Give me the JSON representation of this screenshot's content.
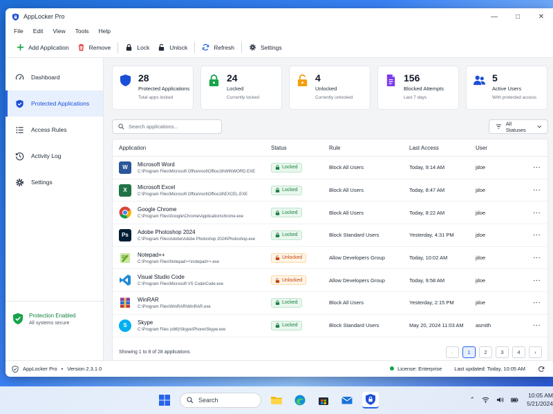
{
  "window": {
    "title": "AppLocker Pro"
  },
  "menu": [
    "File",
    "Edit",
    "View",
    "Tools",
    "Help"
  ],
  "toolbar": {
    "add": "Add Application",
    "remove": "Remove",
    "lock": "Lock",
    "unlock": "Unlock",
    "refresh": "Refresh",
    "settings": "Settings"
  },
  "sidebar": {
    "items": [
      {
        "label": "Dashboard",
        "icon": "gauge-icon"
      },
      {
        "label": "Protected Applications",
        "icon": "shield-check-icon"
      },
      {
        "label": "Access Rules",
        "icon": "list-icon"
      },
      {
        "label": "Activity Log",
        "icon": "history-icon"
      },
      {
        "label": "Settings",
        "icon": "gear-icon"
      }
    ],
    "active_index": 1,
    "protection": {
      "title": "Protection Enabled",
      "subtitle": "All systems secure"
    }
  },
  "stats": [
    {
      "value": "28",
      "label": "Protected Applications",
      "sub": "Total apps locked",
      "icon": "shield-icon",
      "color": "#1d4ed8"
    },
    {
      "value": "24",
      "label": "Locked",
      "sub": "Currently locked",
      "icon": "lock-icon",
      "color": "#16a34a"
    },
    {
      "value": "4",
      "label": "Unlocked",
      "sub": "Currently unlocked",
      "icon": "unlock-icon",
      "color": "#f59e0b"
    },
    {
      "value": "156",
      "label": "Blocked Attempts",
      "sub": "Last 7 days",
      "icon": "file-blocked-icon",
      "color": "#7c3aed"
    },
    {
      "value": "5",
      "label": "Active Users",
      "sub": "With protected access",
      "icon": "users-icon",
      "color": "#1d4ed8"
    }
  ],
  "search": {
    "placeholder": "Search applications..."
  },
  "filter": {
    "label": "All Statuses"
  },
  "table": {
    "headers": [
      "Application",
      "Status",
      "Rule",
      "Last Access",
      "User"
    ],
    "rows": [
      {
        "name": "Microsoft Word",
        "path": "C:\\Program Files\\Microsoft Office\\root\\Office16\\WINWORD.EXE",
        "status": "Locked",
        "rule": "Block All Users",
        "last": "Today, 9:14 AM",
        "user": "jdoe",
        "icon": "word-icon",
        "icon_text": "W",
        "color": "#2b579a"
      },
      {
        "name": "Microsoft Excel",
        "path": "C:\\Program Files\\Microsoft Office\\root\\Office16\\EXCEL.EXE",
        "status": "Locked",
        "rule": "Block All Users",
        "last": "Today, 8:47 AM",
        "user": "jdoe",
        "icon": "excel-icon",
        "icon_text": "X",
        "color": "#217346"
      },
      {
        "name": "Google Chrome",
        "path": "C:\\Program Files\\Google\\Chrome\\Application\\chrome.exe",
        "status": "Locked",
        "rule": "Block All Users",
        "last": "Today, 8:22 AM",
        "user": "jdoe",
        "icon": "chrome-icon",
        "icon_text": "",
        "color": "#ffffff"
      },
      {
        "name": "Adobe Photoshop 2024",
        "path": "C:\\Program Files\\Adobe\\Adobe Photoshop 2024\\Photoshop.exe",
        "status": "Locked",
        "rule": "Block Standard Users",
        "last": "Yesterday, 4:31 PM",
        "user": "jdoe",
        "icon": "photoshop-icon",
        "icon_text": "Ps",
        "color": "#001e36"
      },
      {
        "name": "Notepad++",
        "path": "C:\\Program Files\\Notepad++\\notepad++.exe",
        "status": "Unlocked",
        "rule": "Allow Developers Group",
        "last": "Today, 10:02 AM",
        "user": "jdoe",
        "icon": "notepadpp-icon",
        "icon_text": "",
        "color": "#90c43c"
      },
      {
        "name": "Visual Studio Code",
        "path": "C:\\Program Files\\Microsoft VS Code\\Code.exe",
        "status": "Unlocked",
        "rule": "Allow Developers Group",
        "last": "Today, 9:58 AM",
        "user": "jdoe",
        "icon": "vscode-icon",
        "icon_text": "",
        "color": "#ffffff"
      },
      {
        "name": "WinRAR",
        "path": "C:\\Program Files\\WinRAR\\WinRAR.exe",
        "status": "Locked",
        "rule": "Block All Users",
        "last": "Yesterday, 2:15 PM",
        "user": "jdoe",
        "icon": "winrar-icon",
        "icon_text": "",
        "color": "#7b2c8f"
      },
      {
        "name": "Skype",
        "path": "C:\\Program Files (x86)\\Skype\\Phone\\Skype.exe",
        "status": "Locked",
        "rule": "Block Standard Users",
        "last": "May 20, 2024 11:03 AM",
        "user": "asmith",
        "icon": "skype-icon",
        "icon_text": "S",
        "color": "#00aff0"
      }
    ],
    "footer": "Showing 1 to 8 of 28 applications",
    "pages": [
      "1",
      "2",
      "3",
      "4"
    ],
    "current_page": "1"
  },
  "statusbar": {
    "app": "AppLocker Pro",
    "sep": "•",
    "version": "Version 2.3.1.0",
    "license": "License: Enterprise",
    "updated": "Last updated: Today, 10:05 AM"
  },
  "taskbar": {
    "search": "Search",
    "time": "10:05 AM",
    "date": "5/21/2024"
  }
}
